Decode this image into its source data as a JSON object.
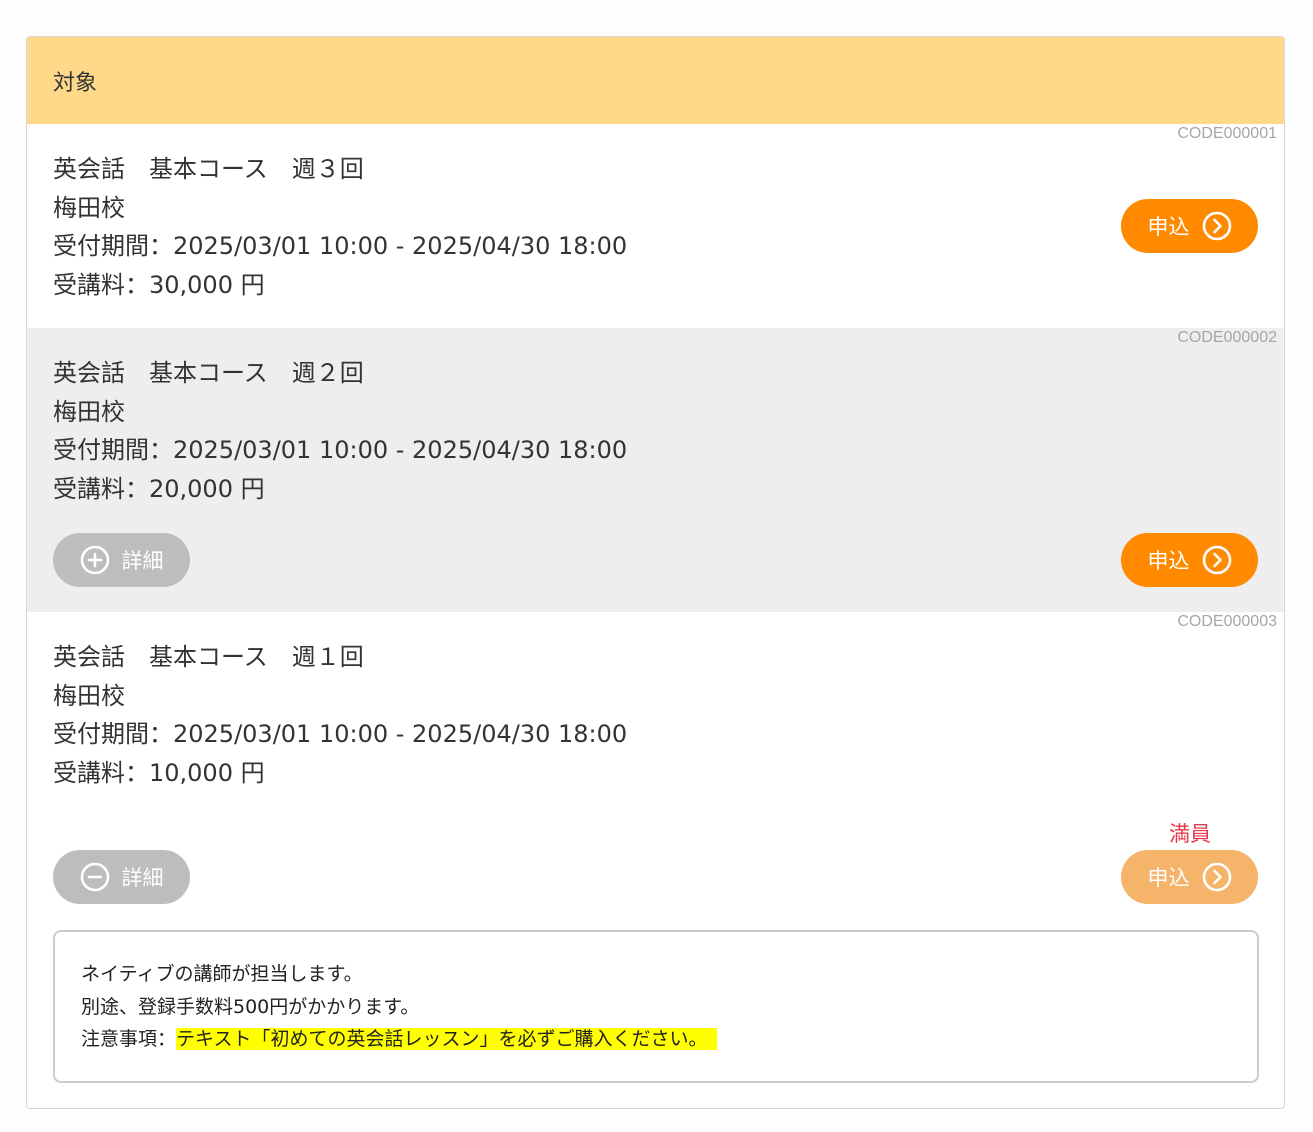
{
  "header": {
    "title": "対象"
  },
  "courses": [
    {
      "code": "CODE000001",
      "name": "英会話　基本コース　週３回",
      "school": "梅田校",
      "period": "受付期間：2025/03/01 10:00 - 2025/04/30 18:00",
      "fee": "受講料：30,000 円",
      "apply_label": "申込"
    },
    {
      "code": "CODE000002",
      "name": "英会話　基本コース　週２回",
      "school": "梅田校",
      "period": "受付期間：2025/03/01 10:00 - 2025/04/30 18:00",
      "fee": "受講料：20,000 円",
      "detail_label": "詳細",
      "apply_label": "申込"
    },
    {
      "code": "CODE000003",
      "name": "英会話　基本コース　週１回",
      "school": "梅田校",
      "period": "受付期間：2025/03/01 10:00 - 2025/04/30 18:00",
      "fee": "受講料：10,000 円",
      "detail_label": "詳細",
      "apply_label": "申込",
      "status": "満員",
      "details": {
        "line1": "ネイティブの講師が担当します。",
        "line2": "別途、登録手数料500円がかかります。",
        "line3_prefix": "注意事項：",
        "line3_highlight": "テキスト「初めての英会話レッスン」を必ずご購入ください。"
      }
    }
  ],
  "colors": {
    "header_bg": "#ffd889",
    "apply": "#ff8a00",
    "apply_disabled": "#f6b46b",
    "detail": "#bdbdbd",
    "full": "#e8374c",
    "highlight": "#ffff00"
  },
  "icons": {
    "apply": "chevron-right-circle-icon",
    "detail_collapsed": "plus-circle-icon",
    "detail_expanded": "minus-circle-icon"
  }
}
